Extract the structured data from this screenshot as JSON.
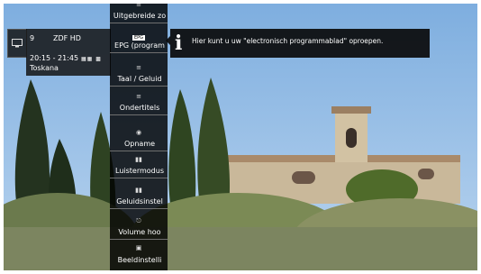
{
  "channel": {
    "number": "9",
    "name": "ZDF HD",
    "time": "20:15 - 21:45",
    "program": "Toskana",
    "tv_icon": "tv-icon"
  },
  "menu": {
    "items": [
      {
        "label": "Uitgebreide zo",
        "icon": "list-icon"
      },
      {
        "label": "EPG (program",
        "icon": "epg-icon",
        "icon_text": "EPG",
        "selected": true
      },
      {
        "label": "Taal / Geluid",
        "icon": "language-icon"
      },
      {
        "label": "Ondertitels",
        "icon": "subtitles-icon"
      },
      {
        "label": "Opname",
        "icon": "record-icon"
      },
      {
        "label": "Luistermodus",
        "icon": "listen-mode-icon"
      },
      {
        "label": "Geluidsinstel",
        "icon": "sound-settings-icon"
      },
      {
        "label": "Volume hoo",
        "icon": "headphone-volume-icon"
      },
      {
        "label": "Beeldinstelli",
        "icon": "picture-settings-icon"
      }
    ]
  },
  "tooltip": {
    "text": "Hier kunt u uw \"electronisch programmablad\" oproepen."
  },
  "colors": {
    "menu_bg": "#000000",
    "highlight": "#ffffff"
  }
}
